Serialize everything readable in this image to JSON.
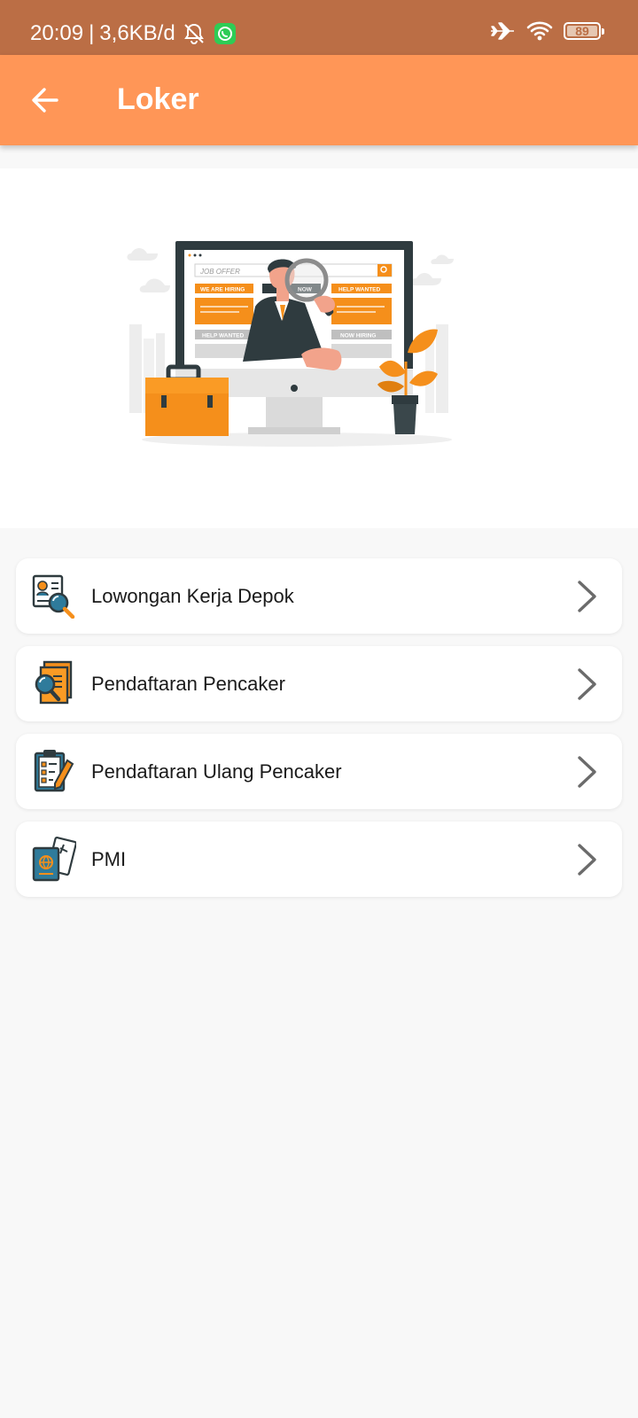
{
  "status_bar": {
    "time": "20:09",
    "separator": "|",
    "net_speed": "3,6KB/d",
    "battery": "89",
    "icons": [
      "mute-icon",
      "whatsapp-icon",
      "airplane-icon",
      "wifi-icon",
      "battery-icon"
    ],
    "background": "#bb6e45"
  },
  "app_bar": {
    "title": "Loker",
    "back_icon": "arrow-left-icon",
    "background": "#ff9657"
  },
  "banner": {
    "illustration": "job-search-illustration",
    "screen_texts": {
      "search": "JOB OFFER",
      "tag1": "WE ARE HIRING",
      "tag2": "NOW",
      "tag3": "HELP WANTED",
      "tag4": "HELP WANTED",
      "tag5": "NOW HIRING"
    },
    "accent": "#f58f1b"
  },
  "menu": {
    "items": [
      {
        "label": "Lowongan Kerja Depok",
        "icon": "job-search-icon"
      },
      {
        "label": "Pendaftaran Pencaker",
        "icon": "document-search-icon"
      },
      {
        "label": "Pendaftaran Ulang Pencaker",
        "icon": "clipboard-checklist-icon"
      },
      {
        "label": "PMI",
        "icon": "passport-ticket-icon"
      }
    ],
    "chevron_icon": "chevron-right-icon"
  }
}
